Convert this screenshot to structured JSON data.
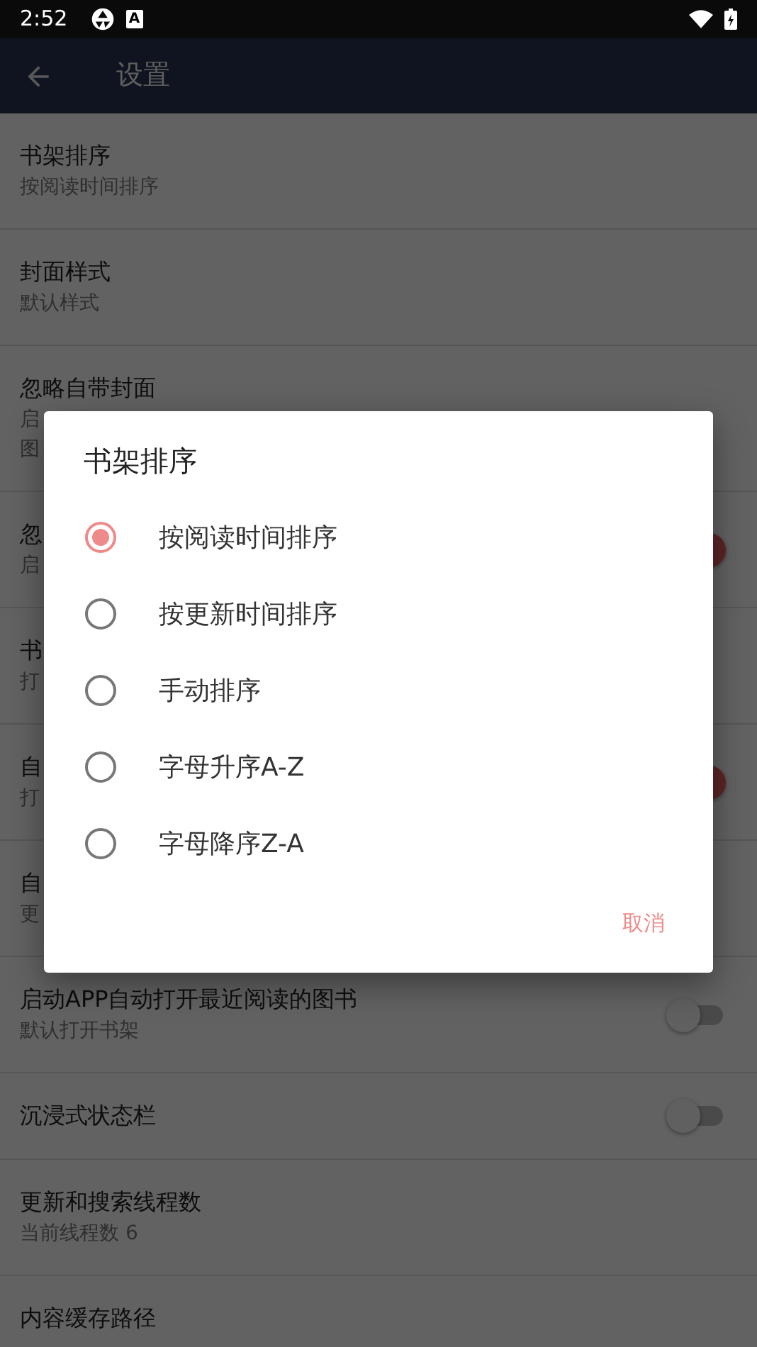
{
  "status_bar": {
    "time": "2:52",
    "badge_letter": "A"
  },
  "toolbar": {
    "title": "设置"
  },
  "settings": [
    {
      "kind": "text",
      "title": "书架排序",
      "subtitle": [
        "按阅读时间排序"
      ]
    },
    {
      "kind": "text",
      "title": "封面样式",
      "subtitle": [
        "默认样式"
      ]
    },
    {
      "kind": "text",
      "title": "忽略自带封面",
      "subtitle": [
        "启",
        "图"
      ]
    },
    {
      "kind": "switch",
      "on": true,
      "title": "忽",
      "subtitle": [
        "启"
      ]
    },
    {
      "kind": "text",
      "title": "书",
      "subtitle": [
        "打"
      ]
    },
    {
      "kind": "switch",
      "on": true,
      "title": "自",
      "subtitle": [
        "打"
      ]
    },
    {
      "kind": "text",
      "title": "自",
      "subtitle": [
        "更"
      ]
    },
    {
      "kind": "switch",
      "on": false,
      "title": "启动APP自动打开最近阅读的图书",
      "subtitle": [
        "默认打开书架"
      ]
    },
    {
      "kind": "switch",
      "on": false,
      "title": "沉浸式状态栏"
    },
    {
      "kind": "text",
      "title": "更新和搜索线程数",
      "subtitle": [
        "当前线程数 6"
      ]
    },
    {
      "kind": "text",
      "title": "内容缓存路径"
    }
  ],
  "dialog": {
    "title": "书架排序",
    "options": [
      {
        "label": "按阅读时间排序",
        "selected": true
      },
      {
        "label": "按更新时间排序",
        "selected": false
      },
      {
        "label": "手动排序",
        "selected": false
      },
      {
        "label": "字母升序A-Z",
        "selected": false
      },
      {
        "label": "字母降序Z-A",
        "selected": false
      }
    ],
    "cancel": "取消"
  }
}
